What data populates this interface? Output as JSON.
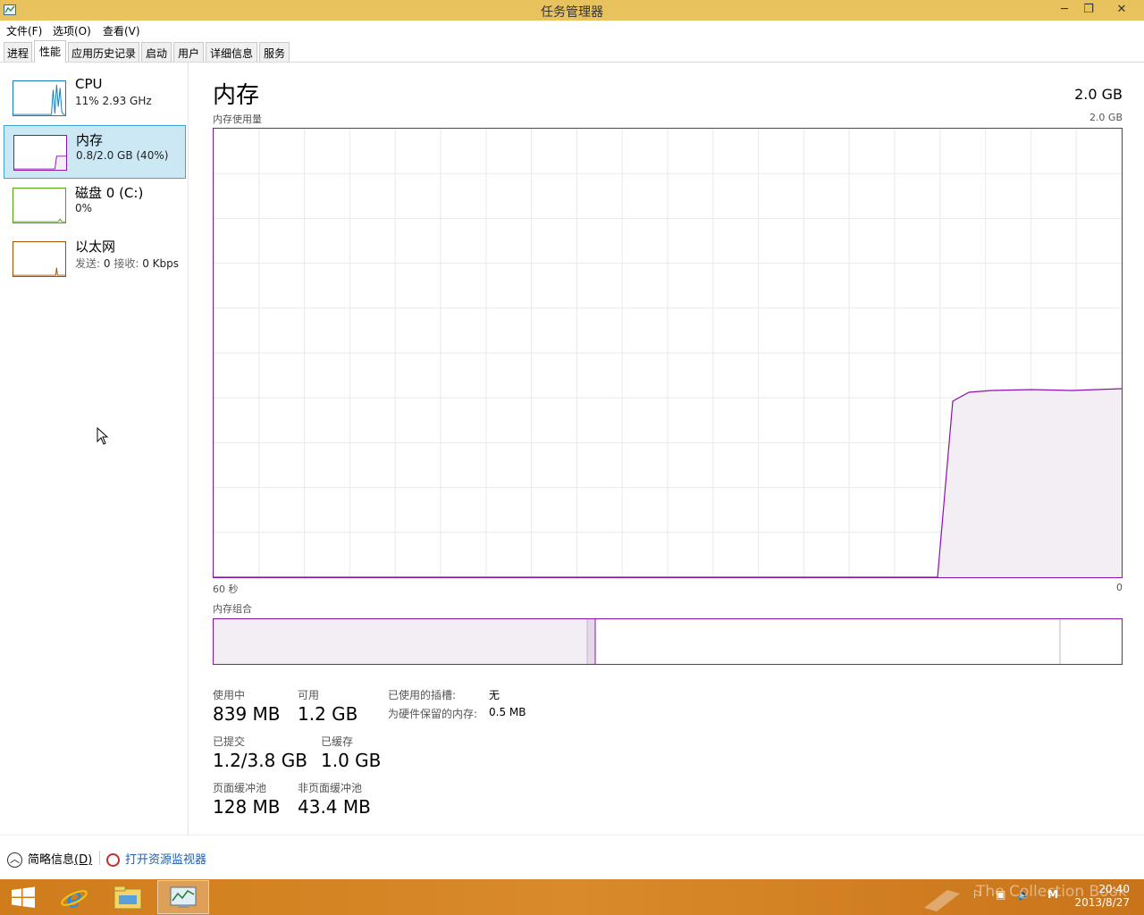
{
  "window": {
    "title": "任务管理器",
    "minimize_glyph": "─",
    "restore_glyph": "❐",
    "close_glyph": "✕"
  },
  "menu": {
    "file": "文件(F)",
    "options": "选项(O)",
    "view": "查看(V)"
  },
  "tabs": [
    {
      "label": "进程"
    },
    {
      "label": "性能",
      "active": true
    },
    {
      "label": "应用历史记录"
    },
    {
      "label": "启动"
    },
    {
      "label": "用户"
    },
    {
      "label": "详细信息"
    },
    {
      "label": "服务"
    }
  ],
  "resources": [
    {
      "name": "CPU",
      "detail": "11% 2.93 GHz",
      "color": "#117dbb"
    },
    {
      "name": "内存",
      "detail": "0.8/2.0 GB (40%)",
      "color": "#8b12ae",
      "selected": true
    },
    {
      "name": "磁盘 0 (C:)",
      "detail": "0%",
      "color": "#4da60c"
    },
    {
      "name": "以太网",
      "send_label": "发送:",
      "send_value": "0",
      "recv_label": "接收:",
      "recv_value": "0 Kbps",
      "color": "#a74f01"
    }
  ],
  "memory": {
    "title": "内存",
    "total": "2.0 GB",
    "usage_label": "内存使用量",
    "graph_max": "2.0 GB",
    "axis_left": "60 秒",
    "axis_right": "0",
    "composition_label": "内存组合",
    "in_use_label": "使用中",
    "in_use_value": "839 MB",
    "available_label": "可用",
    "available_value": "1.2 GB",
    "committed_label": "已提交",
    "committed_value": "1.2/3.8 GB",
    "cached_label": "已缓存",
    "cached_value": "1.0 GB",
    "paged_label": "页面缓冲池",
    "paged_value": "128 MB",
    "nonpaged_label": "非页面缓冲池",
    "nonpaged_value": "43.4 MB",
    "slots_label": "已使用的插槽:",
    "slots_value": "无",
    "reserved_label": "为硬件保留的内存:",
    "reserved_value": "0.5 MB",
    "accent": "#8b12ae"
  },
  "footer": {
    "fewer_details": "简略信息",
    "fewer_shortcut": "(D)",
    "open_resmon": "打开资源监视器"
  },
  "taskbar": {
    "time": "20:40",
    "date": "2013/8/27",
    "ime": "M",
    "watermark": "The Collection Book"
  }
}
